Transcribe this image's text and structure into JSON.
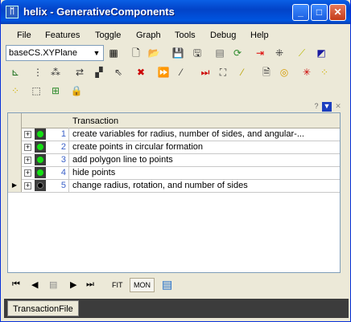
{
  "window": {
    "title": "helix - GenerativeComponents",
    "app_icon_glyph": "ᛖ"
  },
  "window_buttons": {
    "minimize": "_",
    "maximize": "□",
    "close": "✕"
  },
  "menu": [
    {
      "label": "File"
    },
    {
      "label": "Features"
    },
    {
      "label": "Toggle"
    },
    {
      "label": "Graph"
    },
    {
      "label": "Tools"
    },
    {
      "label": "Debug"
    },
    {
      "label": "Help"
    }
  ],
  "toolbar": {
    "combo_value": "baseCS.XYPlane",
    "combo_arrow": "▼",
    "row1_icons": [
      {
        "name": "grid-icon",
        "glyph": "▦",
        "color": "#000"
      },
      {
        "name": "new-file-icon",
        "glyph": "🗋",
        "color": "#000"
      },
      {
        "name": "open-folder-icon",
        "glyph": "📂",
        "color": "#c89a1b"
      },
      {
        "name": "save-icon",
        "glyph": "💾",
        "color": "#777"
      },
      {
        "name": "save-as-icon",
        "glyph": "🖫",
        "color": "#333"
      },
      {
        "name": "script-icon",
        "glyph": "▤",
        "color": "#666"
      },
      {
        "name": "refresh-icon",
        "glyph": "⟳",
        "color": "#2a8a2a"
      },
      {
        "name": "point-insert-icon",
        "glyph": "⇥",
        "color": "#d00"
      },
      {
        "name": "point-pick-icon",
        "glyph": "⁜",
        "color": "#333"
      },
      {
        "name": "line-tool-icon",
        "glyph": "⟋",
        "color": "#b8b800"
      },
      {
        "name": "plane-tool-icon",
        "glyph": "◩",
        "color": "#1a1aa0"
      }
    ],
    "row2_icons": [
      {
        "name": "axis-icon",
        "glyph": "⊾",
        "color": "#1a6e1a"
      },
      {
        "name": "copy-points-icon",
        "glyph": "⋮",
        "color": "#333"
      },
      {
        "name": "replicate-icon",
        "glyph": "⁂",
        "color": "#333"
      },
      {
        "name": "transform-icon",
        "glyph": "⇄",
        "color": "#333"
      },
      {
        "name": "array-icon",
        "glyph": "▞",
        "color": "#333"
      },
      {
        "name": "move-icon",
        "glyph": "⇖",
        "color": "#333"
      },
      {
        "name": "delete-icon",
        "glyph": "✖",
        "color": "#c00"
      },
      {
        "name": "play-forward-icon",
        "glyph": "⏩",
        "color": "#c89a00"
      },
      {
        "name": "slash-icon",
        "glyph": "⁄",
        "color": "#333"
      },
      {
        "name": "step-icon",
        "glyph": "⏭",
        "color": "#c00"
      },
      {
        "name": "graph-nodes-icon",
        "glyph": "⛶",
        "color": "#333"
      },
      {
        "name": "polyline-icon",
        "glyph": "⁄",
        "color": "#b8a000"
      },
      {
        "name": "document-icon",
        "glyph": "🗎",
        "color": "#333"
      },
      {
        "name": "spiral-icon",
        "glyph": "◎",
        "color": "#d49a00"
      },
      {
        "name": "disable-points-icon",
        "glyph": "✳",
        "color": "#c00"
      },
      {
        "name": "point-set-icon",
        "glyph": "⁘",
        "color": "#d0b000"
      }
    ],
    "row3_icons": [
      {
        "name": "dots-icon",
        "glyph": "⁘",
        "color": "#d0b000"
      },
      {
        "name": "cube-icon",
        "glyph": "⬚",
        "color": "#333"
      },
      {
        "name": "component-icon",
        "glyph": "⊞",
        "color": "#2a8a2a"
      },
      {
        "name": "lock-icon",
        "glyph": "🔒",
        "color": "#999"
      }
    ]
  },
  "panel_header": {
    "help_glyph": "?",
    "dropdown_glyph": "▼",
    "close_glyph": "✕"
  },
  "table": {
    "column_header": "Transaction",
    "rows": [
      {
        "num": "1",
        "text": "create variables for radius, number of sides, and angular-...",
        "active": true,
        "current": false
      },
      {
        "num": "2",
        "text": "create points in circular formation",
        "active": true,
        "current": false
      },
      {
        "num": "3",
        "text": "add polygon line to points",
        "active": true,
        "current": false
      },
      {
        "num": "4",
        "text": "hide points",
        "active": true,
        "current": false
      },
      {
        "num": "5",
        "text": "change radius, rotation, and number of sides",
        "active": false,
        "current": true
      }
    ],
    "expand_glyph": "+",
    "current_row_glyph": "▶"
  },
  "navbar": {
    "first_glyph": "⏮",
    "prev_glyph": "◀",
    "step_glyph": "▤",
    "next_glyph": "▶",
    "last_glyph": "⏭",
    "fit_label": "FIT",
    "mon_label": "MON",
    "list_glyph": "▤"
  },
  "statusbar": {
    "tab_label": "TransactionFile"
  }
}
